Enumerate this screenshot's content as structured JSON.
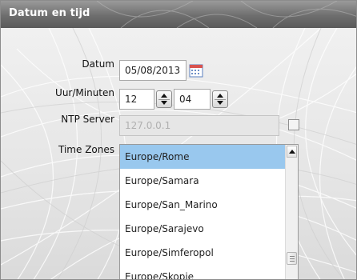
{
  "window": {
    "title": "Datum en tijd"
  },
  "form": {
    "date_label": "Datum",
    "date_value": "05/08/2013",
    "time_label": "Uur/Minuten",
    "hour_value": "12",
    "minute_value": "04",
    "ntp_label": "NTP Server",
    "ntp_value": "127.0.0.1",
    "ntp_checked": false,
    "timezone_label": "Time Zones"
  },
  "timezones": {
    "items": [
      {
        "label": "Europe/Rome",
        "selected": true
      },
      {
        "label": "Europe/Samara",
        "selected": false
      },
      {
        "label": "Europe/San_Marino",
        "selected": false
      },
      {
        "label": "Europe/Sarajevo",
        "selected": false
      },
      {
        "label": "Europe/Simferopol",
        "selected": false
      },
      {
        "label": "Europe/Skopje",
        "selected": false
      }
    ]
  },
  "icons": {
    "calendar": "calendar-icon",
    "spinner": "spinner-arrows-icon",
    "scroll_up": "scroll-up-arrow-icon",
    "scroll_thumb": "scroll-thumb-grip-icon"
  },
  "colors": {
    "titlebar": "#6e6e6e",
    "selection": "#99c8ee",
    "background": "#e8e8e8"
  }
}
